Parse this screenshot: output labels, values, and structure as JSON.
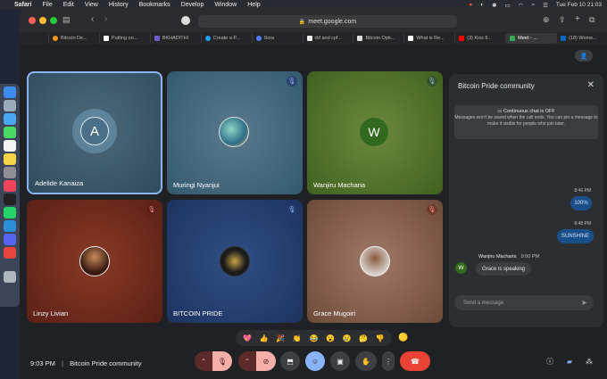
{
  "menubar": {
    "app": "Safari",
    "items": [
      "File",
      "Edit",
      "View",
      "History",
      "Bookmarks",
      "Develop",
      "Window",
      "Help"
    ],
    "datetime": "Tue Feb 10  21:03"
  },
  "browser": {
    "url": "meet.google.com",
    "tabs": [
      {
        "label": "Bitcoin De...",
        "color": "#f7931a"
      },
      {
        "label": "Putting on...",
        "color": "#ffffff"
      },
      {
        "label": "BKHADITHI",
        "color": "#6f5bd0"
      },
      {
        "label": "Create a P...",
        "color": "#1da1f2"
      },
      {
        "label": "Sora",
        "color": "#4f7cff"
      },
      {
        "label": "rbf and cpf...",
        "color": "#eeeeee"
      },
      {
        "label": "Bitcoin Opti...",
        "color": "#dddddd"
      },
      {
        "label": "What is Re...",
        "color": "#ffffff"
      },
      {
        "label": "(3) Kiss 9...",
        "color": "#ff0000"
      },
      {
        "label": "Meet - ...",
        "color": "#34a853"
      },
      {
        "label": "(18) Wome...",
        "color": "#0a66c2"
      }
    ]
  },
  "participants": [
    {
      "name": "Adelide Kanaiza",
      "initial": "A"
    },
    {
      "name": "Muringi Nyanjui",
      "initial": ""
    },
    {
      "name": "Wanjiru Macharia",
      "initial": "W"
    },
    {
      "name": "Linzy Livian",
      "initial": ""
    },
    {
      "name": "BITCOIN PRIDE",
      "initial": ""
    },
    {
      "name": "Grace Mugoiri",
      "initial": ""
    }
  ],
  "chat": {
    "title": "Bitcoin Pride community",
    "notice_title": "Continuous chat is OFF",
    "notice_body": "Messages won't be saved when the call ends. You can pin a message to make it visible for people who join later.",
    "messages": [
      {
        "time": "8:46 PM",
        "text": "100%"
      },
      {
        "time": "8:48 PM",
        "text": "SUNSHINE"
      }
    ],
    "incoming": {
      "sender": "Wanjiru Macharia",
      "initial": "W",
      "time": "9:00 PM",
      "text": "Grace is speaking"
    },
    "input_placeholder": "Send a message"
  },
  "reactions": [
    "💖",
    "👍",
    "🎉",
    "👏",
    "😂",
    "😮",
    "😢",
    "🤔",
    "👎"
  ],
  "meeting": {
    "time": "9:03 PM",
    "separator": "|",
    "name": "Bitcoin Pride community"
  }
}
